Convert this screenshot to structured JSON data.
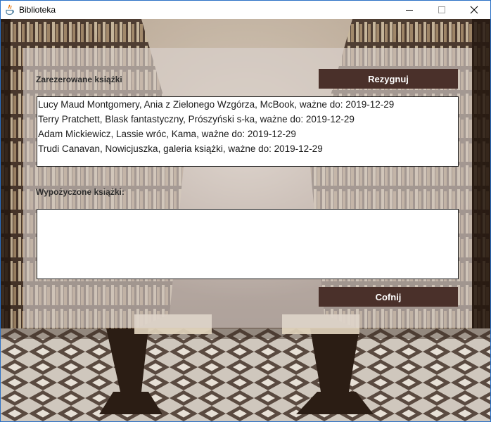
{
  "window": {
    "title": "Biblioteka",
    "icons": {
      "app": "java-cup-icon",
      "minimize": "minimize-icon",
      "maximize": "maximize-icon",
      "close": "close-icon"
    }
  },
  "reserved": {
    "label": "Zarezerowane książki",
    "cancel_button": "Rezygnuj",
    "items": [
      "Lucy Maud Montgomery, Ania z Zielonego Wzgórza, McBook, ważne do: 2019-12-29",
      "Terry Pratchett, Blask fantastyczny, Prószyński s-ka, ważne do: 2019-12-29",
      "Adam Mickiewicz, Lassie wróc, Kama, ważne do: 2019-12-29",
      "Trudi Canavan, Nowicjuszka, galeria książki, ważne do: 2019-12-29"
    ]
  },
  "borrowed": {
    "label": "Wypożyczone książki:",
    "items": []
  },
  "back_button": "Cofnij",
  "colors": {
    "button_bg": "#4a302a",
    "button_text": "#ffffff",
    "panel_overlay": "rgba(220,212,208,0.62)",
    "window_border": "#2b71c6"
  }
}
